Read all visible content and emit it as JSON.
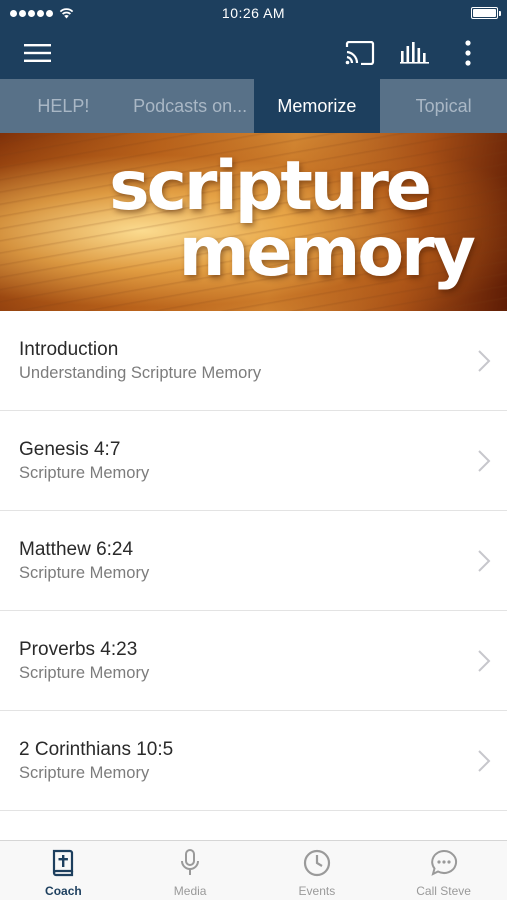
{
  "status_bar": {
    "time": "10:26 AM",
    "signal_icon": "signal-dots-icon",
    "wifi_icon": "wifi-icon",
    "battery_icon": "battery-icon"
  },
  "app_bar": {
    "menu_icon": "hamburger-menu-icon",
    "cast_icon": "cast-icon",
    "bars_icon": "audio-bars-icon",
    "more_icon": "more-vertical-icon"
  },
  "tabs": [
    {
      "label": "HELP!",
      "active": false
    },
    {
      "label": "Podcasts on...",
      "active": false
    },
    {
      "label": "Memorize",
      "active": true
    },
    {
      "label": "Topical",
      "active": false
    }
  ],
  "banner": {
    "line1": "scripture",
    "line2": "memory"
  },
  "list": [
    {
      "title": "Introduction",
      "subtitle": "Understanding Scripture Memory"
    },
    {
      "title": "Genesis 4:7",
      "subtitle": "Scripture Memory"
    },
    {
      "title": "Matthew 6:24",
      "subtitle": "Scripture Memory"
    },
    {
      "title": "Proverbs 4:23",
      "subtitle": "Scripture Memory"
    },
    {
      "title": "2 Corinthians 10:5",
      "subtitle": "Scripture Memory"
    }
  ],
  "bottom_nav": [
    {
      "label": "Coach",
      "icon": "bible-icon",
      "active": true
    },
    {
      "label": "Media",
      "icon": "microphone-icon",
      "active": false
    },
    {
      "label": "Events",
      "icon": "clock-icon",
      "active": false
    },
    {
      "label": "Call Steve",
      "icon": "chat-bubble-icon",
      "active": false
    }
  ],
  "colors": {
    "primary": "#1d3f5e",
    "tab_bg": "#587188",
    "active_nav": "#1d3f5e",
    "inactive_nav": "#9a9a9a"
  }
}
